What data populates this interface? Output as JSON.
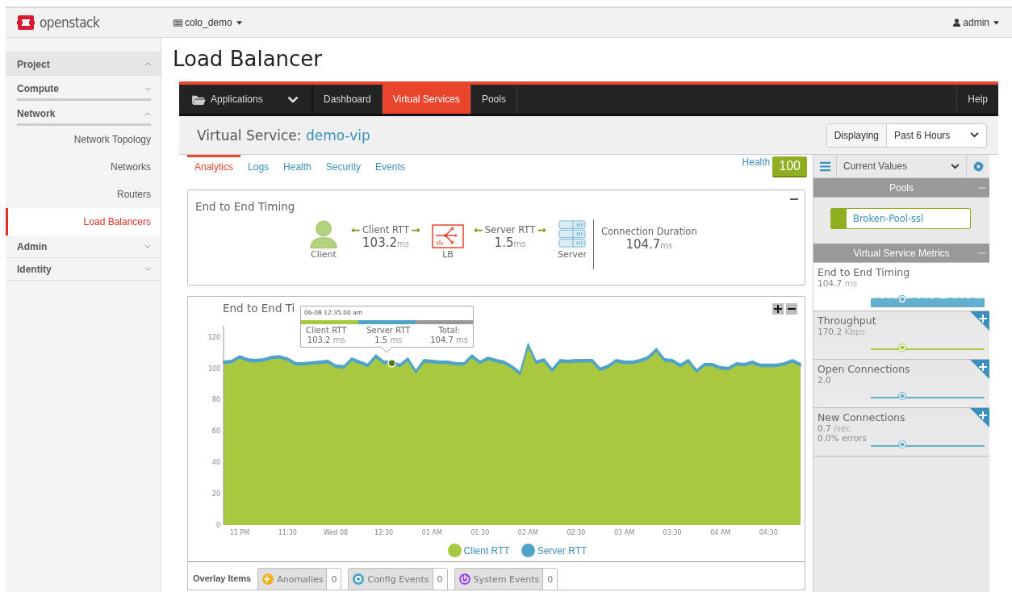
{
  "topbar": {
    "brand": "openstack",
    "project": "colo_demo",
    "user": "admin"
  },
  "sidebar": {
    "items": [
      {
        "label": "Project",
        "expanded": true,
        "children": [
          {
            "label": "Compute",
            "expanded": false
          },
          {
            "label": "Network",
            "expanded": true,
            "children": [
              {
                "label": "Network Topology",
                "selected": false
              },
              {
                "label": "Networks",
                "selected": false
              },
              {
                "label": "Routers",
                "selected": false
              },
              {
                "label": "Load Balancers",
                "selected": true
              }
            ]
          }
        ]
      },
      {
        "label": "Admin",
        "expanded": false
      },
      {
        "label": "Identity",
        "expanded": false
      }
    ]
  },
  "page_title": "Load Balancer",
  "app_nav": {
    "items": [
      {
        "label": "Applications",
        "kind": "dropdown",
        "selected": false
      },
      {
        "label": "Dashboard",
        "kind": "tab",
        "selected": false
      },
      {
        "label": "Virtual Services",
        "kind": "tab",
        "selected": true
      },
      {
        "label": "Pools",
        "kind": "tab",
        "selected": false
      }
    ],
    "help": "Help"
  },
  "service_header": {
    "label": "Virtual Service:",
    "name": "demo-vip",
    "displaying": "Displaying",
    "range": "Past 6 Hours"
  },
  "subtabs": [
    {
      "label": "Analytics",
      "selected": true
    },
    {
      "label": "Logs",
      "selected": false
    },
    {
      "label": "Health",
      "selected": false
    },
    {
      "label": "Security",
      "selected": false
    },
    {
      "label": "Events",
      "selected": false
    }
  ],
  "health": {
    "label": "Health",
    "score": "100"
  },
  "timing_card": {
    "title": "End to End Timing",
    "client": "Client",
    "client_rtt_label": "Client RTT",
    "client_rtt": "103.2",
    "client_rtt_unit": "ms",
    "lb": "LB",
    "server_rtt_label": "Server RTT",
    "server_rtt": "1.5",
    "server_rtt_unit": "ms",
    "server": "Server",
    "duration_label": "Connection Duration",
    "duration": "104.7",
    "duration_unit": "ms"
  },
  "chart_card": {
    "title": "End to End Ti",
    "tooltip": {
      "time": "06-08 12:35:00 am",
      "columns": [
        {
          "label": "Client RTT",
          "value": "103.2",
          "unit": "ms"
        },
        {
          "label": "Server RTT",
          "value": "1.5",
          "unit": "ms"
        },
        {
          "label": "Total:",
          "value": "104.7",
          "unit": "ms"
        }
      ]
    },
    "chart_data": {
      "type": "area",
      "stacked": true,
      "ylim": [
        0,
        127
      ],
      "categories": [
        null,
        null,
        "11 PM",
        null,
        null,
        null,
        null,
        null,
        "11:30",
        null,
        null,
        null,
        null,
        null,
        "Wed 08",
        null,
        null,
        null,
        null,
        null,
        "12:30",
        null,
        null,
        null,
        null,
        null,
        "01 AM",
        null,
        null,
        null,
        null,
        null,
        "01:30",
        null,
        null,
        null,
        null,
        null,
        "02 AM",
        null,
        null,
        null,
        null,
        null,
        "02:30",
        null,
        null,
        null,
        null,
        null,
        "03 AM",
        null,
        null,
        null,
        null,
        null,
        "03:30",
        null,
        null,
        null,
        null,
        null,
        "04 AM",
        null,
        null,
        null,
        null,
        null,
        "04:30",
        null,
        null,
        null,
        null
      ],
      "series": [
        {
          "name": "Client RTT",
          "color": "#a8c93f",
          "values": [
            103,
            103.5,
            106.5,
            104.5,
            104,
            104.5,
            106,
            106.5,
            105,
            102,
            102,
            102.5,
            103,
            103.5,
            100.5,
            100,
            105,
            103,
            101,
            107,
            103,
            103.2,
            101,
            105,
            97,
            104,
            103.5,
            103,
            103,
            102,
            102,
            107,
            103,
            105.5,
            104,
            103,
            100,
            96,
            114,
            103,
            104.5,
            98,
            104,
            103.5,
            104,
            104,
            104,
            98.5,
            100.5,
            104,
            103,
            103,
            104,
            106,
            111,
            104.5,
            104,
            101,
            104,
            97.5,
            101.5,
            101.5,
            99.5,
            99,
            102,
            101.5,
            103,
            101,
            101,
            101,
            102,
            104,
            101.5
          ]
        },
        {
          "name": "Server RTT",
          "color": "#4fa3c8",
          "values": [
            1.5,
            1.5,
            1.5,
            1.5,
            1.5,
            1.5,
            1.5,
            1.5,
            1.5,
            1.5,
            1.5,
            1.5,
            1.5,
            1.5,
            1.5,
            1.5,
            1.5,
            1.5,
            1.5,
            1.5,
            1.5,
            1.5,
            1.5,
            1.5,
            1.5,
            1.5,
            1.5,
            1.5,
            1.5,
            1.5,
            1.5,
            1.5,
            1.5,
            1.5,
            1.5,
            1.5,
            1.5,
            1.5,
            1.5,
            1.5,
            1.5,
            1.5,
            1.5,
            1.5,
            1.5,
            1.5,
            1.5,
            1.5,
            1.5,
            1.5,
            1.5,
            1.5,
            1.5,
            1.5,
            1.5,
            1.5,
            1.5,
            1.5,
            1.5,
            1.5,
            1.5,
            1.5,
            1.5,
            1.5,
            1.5,
            1.5,
            1.5,
            1.5,
            1.5,
            1.5,
            1.5,
            1.5,
            1.5
          ]
        }
      ],
      "yticks": [
        0,
        20,
        40,
        60,
        80,
        100,
        120
      ]
    }
  },
  "overlay": {
    "label": "Overlay Items",
    "items": [
      {
        "label": "Anomalies",
        "count": "0",
        "kind": "anomaly",
        "color": "#f0b31f"
      },
      {
        "label": "Config Events",
        "count": "0",
        "kind": "config",
        "color": "#4fa3c8"
      },
      {
        "label": "System Events",
        "count": "0",
        "kind": "system",
        "color": "#9b51e0"
      }
    ]
  },
  "right_panel": {
    "view": "Current Values",
    "pools_title": "Pools",
    "pools": [
      {
        "name": "Broken-Pool-ssl",
        "color": "#8fae22"
      }
    ],
    "metrics_title": "Virtual Service Metrics",
    "metrics": [
      {
        "title": "End to End Timing",
        "value": "104.7",
        "unit": "ms",
        "kind": "area",
        "color": "#62afcf",
        "selected": true
      },
      {
        "title": "Throughput",
        "value": "170.2",
        "unit": "Kbps",
        "kind": "line",
        "color": "#a8c93f",
        "selected": false
      },
      {
        "title": "Open Connections",
        "value": "2.0",
        "kind": "line",
        "color": "#62afcf",
        "selected": false
      },
      {
        "title": "New Connections",
        "value": "0.7",
        "unit": "/sec",
        "extra": "0.0% errors",
        "kind": "line",
        "color": "#62afcf",
        "selected": false
      }
    ]
  }
}
